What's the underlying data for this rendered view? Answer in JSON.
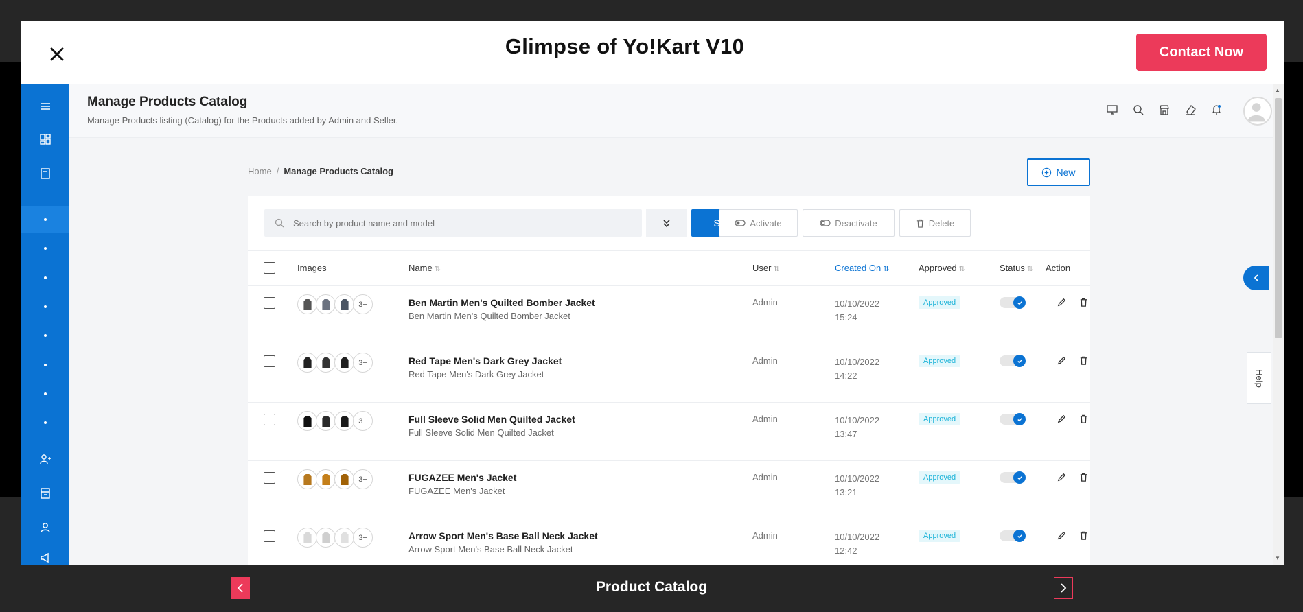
{
  "modal": {
    "title": "Glimpse of Yo!Kart V10",
    "contact_label": "Contact Now"
  },
  "page": {
    "title": "Manage Products Catalog",
    "subtitle": "Manage Products listing (Catalog) for the Products added by Admin and Seller."
  },
  "breadcrumb": {
    "home": "Home",
    "separator": "/",
    "current": "Manage Products Catalog"
  },
  "toolbar": {
    "new_label": "New",
    "search_placeholder": "Search by product name and model",
    "search_label": "Search",
    "activate_label": "Activate",
    "deactivate_label": "Deactivate",
    "delete_label": "Delete"
  },
  "table": {
    "columns": {
      "images": "Images",
      "name": "Name",
      "user": "User",
      "created_on": "Created On",
      "approved": "Approved",
      "status": "Status",
      "action": "Action"
    },
    "rows": [
      {
        "name": "Ben Martin Men's Quilted Bomber Jacket",
        "sub": "Ben Martin Men's Quilted Bomber Jacket",
        "user": "Admin",
        "date": "10/10/2022",
        "time": "15:24",
        "approved": "Approved",
        "more": "3+"
      },
      {
        "name": "Red Tape Men's Dark Grey Jacket",
        "sub": "Red Tape Men's Dark Grey Jacket",
        "user": "Admin",
        "date": "10/10/2022",
        "time": "14:22",
        "approved": "Approved",
        "more": "3+"
      },
      {
        "name": "Full Sleeve Solid Men Quilted Jacket",
        "sub": "Full Sleeve Solid Men Quilted Jacket",
        "user": "Admin",
        "date": "10/10/2022",
        "time": "13:47",
        "approved": "Approved",
        "more": "3+"
      },
      {
        "name": "FUGAZEE Men's Jacket",
        "sub": "FUGAZEE Men's Jacket",
        "user": "Admin",
        "date": "10/10/2022",
        "time": "13:21",
        "approved": "Approved",
        "more": "3+"
      },
      {
        "name": "Arrow Sport Men's Base Ball Neck Jacket",
        "sub": "Arrow Sport Men's Base Ball Neck Jacket",
        "user": "Admin",
        "date": "10/10/2022",
        "time": "12:42",
        "approved": "Approved",
        "more": "3+"
      }
    ]
  },
  "help_label": "Help",
  "footer": {
    "title": "Product Catalog"
  },
  "colors": {
    "brand_blue": "#0b73d3",
    "accent_red": "#ec3a5a",
    "badge_cyan": "#1bb3d8"
  },
  "icons": {
    "sidebar": [
      "menu-icon",
      "dashboard-icon",
      "catalog-icon",
      "dot",
      "dot",
      "dot",
      "dot",
      "dot",
      "dot",
      "dot",
      "dot",
      "user-add-icon",
      "store-icon",
      "user-icon",
      "megaphone-icon"
    ],
    "topbar": [
      "monitor-icon",
      "search-icon",
      "store-icon",
      "eraser-icon",
      "bell-icon"
    ]
  }
}
